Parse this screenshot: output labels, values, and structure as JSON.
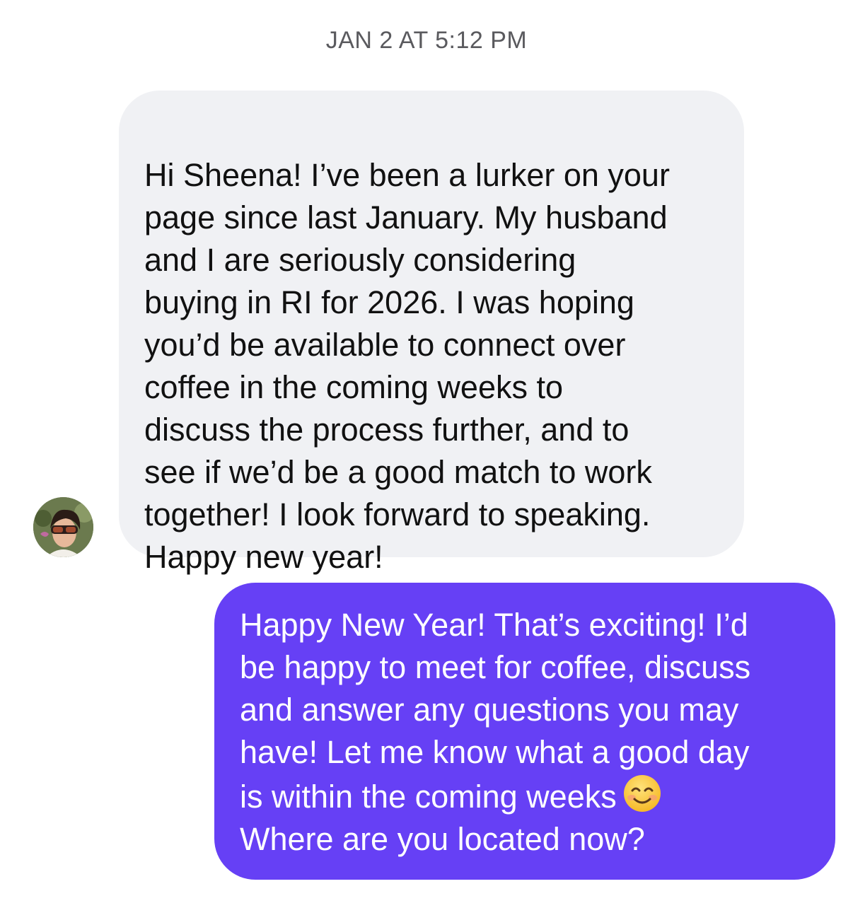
{
  "timestamp": "JAN 2 AT 5:12 PM",
  "messages": [
    {
      "sender": "other",
      "text": "Hi Sheena! I’ve been a lurker on your\npage since last January. My husband\nand I are seriously considering\nbuying in RI for 2026. I was hoping\nyou’d be available to connect over\ncoffee in the coming weeks to\ndiscuss the process further, and to\nsee if we’d be a good match to work\ntogether! I look forward to speaking.\nHappy new year!"
    },
    {
      "sender": "me",
      "text_before_emoji": "Happy New Year! That’s exciting! I’d\nbe happy to meet for coffee, discuss\nand answer any questions you may\nhave! Let me know what a good day\nis within the coming weeks",
      "emoji": "smiling-face-icon",
      "text_after_emoji": "\nWhere are you located now?"
    }
  ],
  "colors": {
    "incoming_bubble": "#f0f1f4",
    "outgoing_bubble": "#6640f5",
    "timestamp_text": "#5a5a5e"
  }
}
